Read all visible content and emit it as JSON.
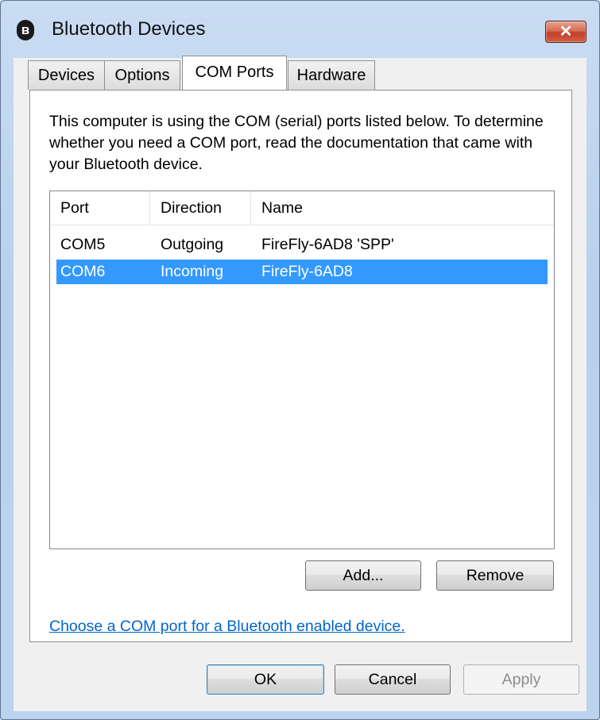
{
  "window": {
    "title": "Bluetooth Devices",
    "title_icon": "bluetooth-icon",
    "close_symbol": "✕"
  },
  "tabs": [
    {
      "label": "Devices",
      "active": false
    },
    {
      "label": "Options",
      "active": false
    },
    {
      "label": "COM Ports",
      "active": true
    },
    {
      "label": "Hardware",
      "active": false
    }
  ],
  "description": "This computer is using the COM (serial) ports listed below. To determine whether you need a COM port, read the documentation that came with your Bluetooth device.",
  "listview": {
    "columns": [
      "Port",
      "Direction",
      "Name"
    ],
    "rows": [
      {
        "port": "COM5",
        "direction": "Outgoing",
        "name": "FireFly-6AD8 'SPP'",
        "selected": false
      },
      {
        "port": "COM6",
        "direction": "Incoming",
        "name": "FireFly-6AD8",
        "selected": true
      }
    ]
  },
  "buttons": {
    "add": "Add...",
    "remove": "Remove",
    "ok": "OK",
    "cancel": "Cancel",
    "apply": "Apply"
  },
  "link_text": "Choose a COM port for a Bluetooth enabled device.",
  "colors": {
    "selection": "#3399ff",
    "link": "#0066cc",
    "close_button": "#c0402a"
  }
}
